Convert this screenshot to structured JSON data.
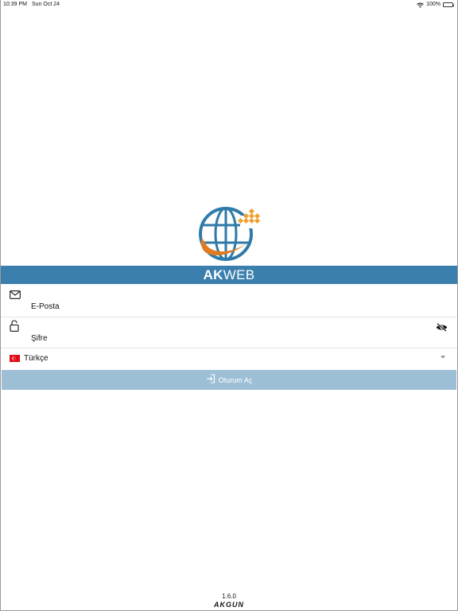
{
  "status_bar": {
    "time": "10:39 PM",
    "date": "Sun Oct 24",
    "battery": "100%"
  },
  "brand": {
    "bold": "AK",
    "rest": "WEB",
    "band_color": "#3b7fae"
  },
  "form": {
    "email": {
      "label": "E-Posta",
      "icon": "envelope-icon"
    },
    "password": {
      "label": "Şifre",
      "icon": "lock-icon",
      "toggle_icon": "eye-off-icon"
    },
    "language": {
      "selected": "Türkçe",
      "flag": "turkey-flag-icon"
    },
    "login_button": {
      "label": "Oturum Aç",
      "icon": "sign-in-icon",
      "color": "#9dbfd6"
    }
  },
  "footer": {
    "version": "1.6.0",
    "company": "AKGUN"
  }
}
